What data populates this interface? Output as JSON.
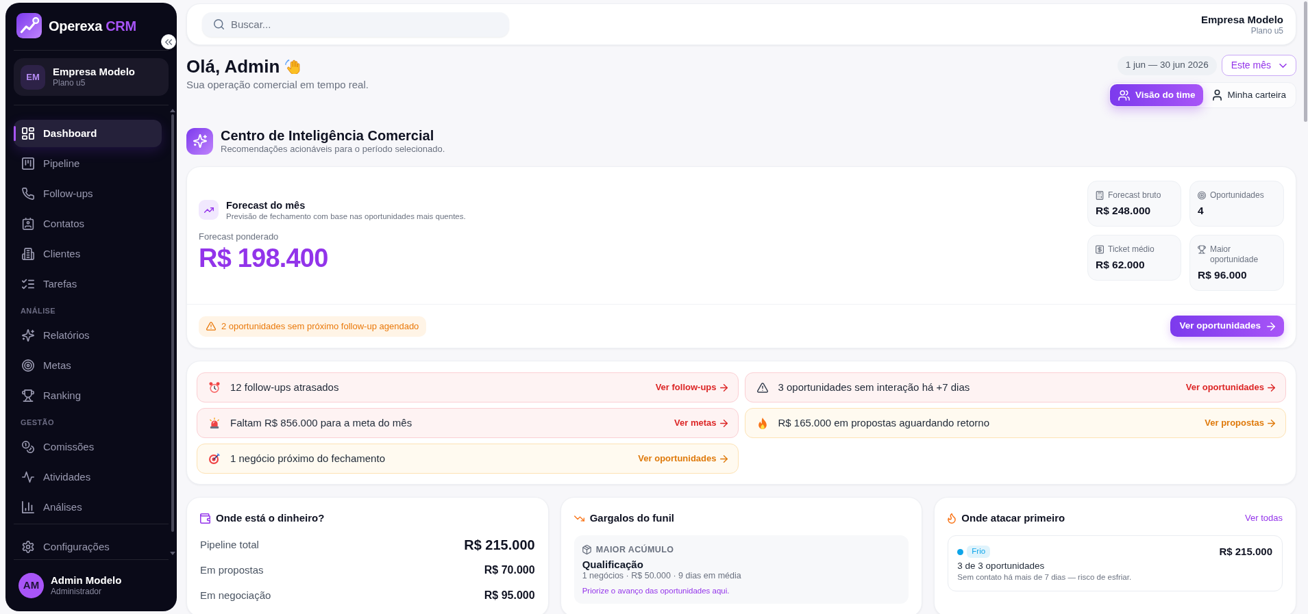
{
  "sidebar": {
    "brand": {
      "name": "Operexa",
      "accent": "CRM"
    },
    "company": {
      "initials": "EM",
      "name": "Empresa Modelo",
      "plan": "Plano u5"
    },
    "nav_groups": [
      {
        "items": [
          {
            "label": "Dashboard",
            "selected": true
          },
          {
            "label": "Pipeline",
            "selected": false
          },
          {
            "label": "Follow-ups",
            "selected": false
          },
          {
            "label": "Contatos",
            "selected": false
          },
          {
            "label": "Clientes",
            "selected": false
          },
          {
            "label": "Tarefas",
            "selected": false
          }
        ]
      },
      {
        "heading": "ANÁLISE",
        "items": [
          {
            "label": "Relatórios",
            "selected": false
          },
          {
            "label": "Metas",
            "selected": false
          },
          {
            "label": "Ranking",
            "selected": false
          }
        ]
      },
      {
        "heading": "GESTÃO",
        "items": [
          {
            "label": "Comissões",
            "selected": false
          },
          {
            "label": "Atividades",
            "selected": false
          },
          {
            "label": "Análises",
            "selected": false
          }
        ]
      }
    ],
    "settings_item": {
      "label": "Configurações",
      "selected": false
    },
    "user": {
      "initials": "AM",
      "name": "Admin Modelo",
      "role": "Administrador"
    }
  },
  "header": {
    "search": {
      "placeholder": "Buscar..."
    },
    "company": {
      "name": "Empresa Modelo",
      "plan": "Plano u5"
    }
  },
  "greeting": {
    "title": "Olá, Admin",
    "subtitle": "Sua operação comercial em tempo real."
  },
  "period": {
    "range": "1 jun — 30 jun 2026",
    "preset": "Este mês"
  },
  "view_toggle": [
    {
      "label": "Visão do time",
      "selected": true
    },
    {
      "label": "Minha carteira",
      "selected": false
    }
  ],
  "intelligence": {
    "title": "Centro de Inteligência Comercial",
    "subtitle": "Recomendações acionáveis para o período selecionado."
  },
  "forecast": {
    "title": "Forecast do mês",
    "subtitle": "Previsão de fechamento com base nas oportunidades mais quentes.",
    "weighted_label": "Forecast ponderado",
    "weighted_value": "R$ 198.400",
    "stats": [
      {
        "label": "Forecast bruto",
        "value": "R$ 248.000"
      },
      {
        "label": "Oportunidades",
        "value": "4"
      },
      {
        "label": "Ticket médio",
        "value": "R$ 62.000"
      },
      {
        "label": "Maior oportunidade",
        "value": "R$ 96.000"
      }
    ],
    "warning": "2 oportunidades sem próximo follow-up agendado",
    "action": "Ver oportunidades"
  },
  "alerts": [
    {
      "kind": "danger",
      "text": "12 follow-ups atrasados",
      "action": "Ver follow-ups"
    },
    {
      "kind": "danger",
      "text": "3 oportunidades sem interação há +7 dias",
      "action": "Ver oportunidades"
    },
    {
      "kind": "danger",
      "text": "Faltam R$ 856.000 para a meta do mês",
      "action": "Ver metas"
    },
    {
      "kind": "warning",
      "text": "R$ 165.000 em propostas aguardando retorno",
      "action": "Ver propostas"
    },
    {
      "kind": "warning",
      "text": "1 negócio próximo do fechamento",
      "action": "Ver oportunidades"
    }
  ],
  "money": {
    "title": "Onde está o dinheiro?",
    "rows": [
      {
        "kind": "total",
        "label": "Pipeline total",
        "value": "R$ 215.000"
      },
      {
        "kind": "stage",
        "label": "Em propostas",
        "value": "R$ 70.000"
      },
      {
        "kind": "stage",
        "label": "Em negociação",
        "value": "R$ 95.000"
      }
    ]
  },
  "bottlenecks": {
    "title": "Gargalos do funil",
    "highlight": {
      "tag": "MAIOR ACÚMULO",
      "stage": "Qualificação",
      "details": "1 negócios · R$ 50.000 · 9 dias em média",
      "hint": "Priorize o avanço das oportunidades aqui."
    }
  },
  "priorities": {
    "title": "Onde atacar primeiro",
    "link": "Ver todas",
    "items": [
      {
        "tag": "Frio",
        "color": "#0ea5e9",
        "value": "R$ 215.000",
        "title": "3 de 3 oportunidades",
        "note": "Sem contato há mais de 7 dias — risco de esfriar."
      }
    ]
  }
}
